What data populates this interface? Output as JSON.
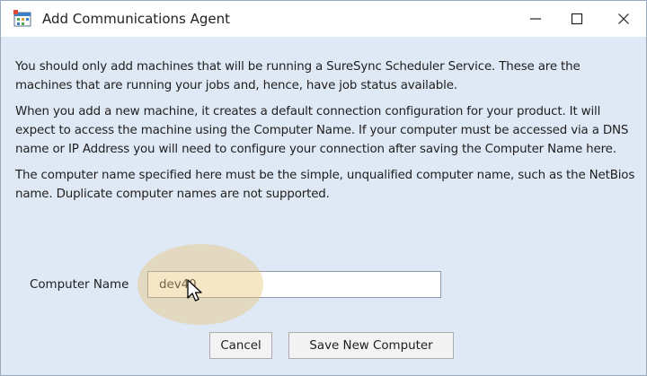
{
  "window": {
    "title": "Add Communications Agent",
    "controls": {
      "minimize": "—",
      "maximize": "☐",
      "close": "✕"
    },
    "app_icon": "scheduler-app-icon"
  },
  "content": {
    "paragraphs": [
      "You should only add machines that will be running a SureSync Scheduler Service. These are the machines that are running your jobs and, hence, have job status available.",
      "When you add a new machine, it creates a default connection configuration for your product. It will expect to access the machine using the Computer Name. If your computer must be accessed via a DNS name or IP Address you will need to configure your connection after saving the Computer Name here.",
      "The computer name specified here must be the simple, unqualified computer name, such as the NetBios name. Duplicate computer names are not supported."
    ]
  },
  "form": {
    "computer_name_label": "Computer Name",
    "computer_name_value": "dev40"
  },
  "buttons": {
    "cancel": "Cancel",
    "save": "Save New Computer"
  },
  "colors": {
    "background": "#dfe8f5",
    "titlebar": "#ffffff",
    "highlight": "#e8c478"
  }
}
